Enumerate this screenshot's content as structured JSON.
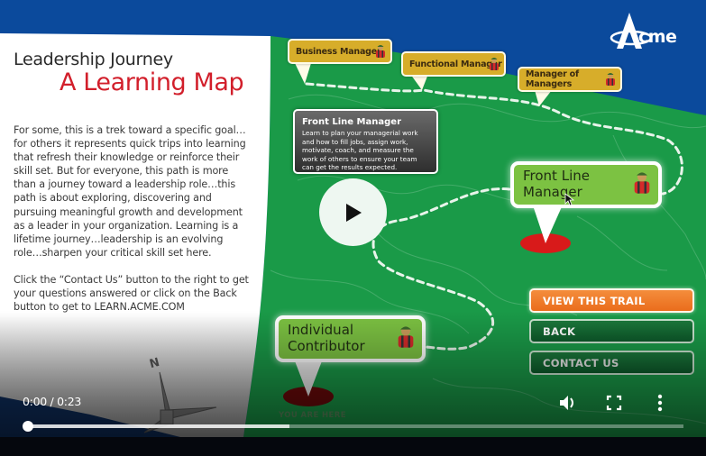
{
  "slide": {
    "title_line1": "Leadership Journey",
    "title_line2": "A Learning Map",
    "intro_paragraph1": "For some, this is a trek toward a specific goal…for others it represents quick trips into learning that refresh their knowledge or reinforce their skill set. But for everyone, this path is more than a journey toward a leadership role…this path is about exploring, discovering and pursuing meaningful growth and development as a leader in your organization. Learning is a lifetime journey…leadership is an evolving role…sharpen your critical skill set here.",
    "intro_paragraph2": "Click the “Contact Us” button to the right to get your questions answered or click on the Back button to get to LEARN.ACME.COM",
    "logo_text": "cme",
    "logo_letter": "A",
    "compass_label": "N",
    "milestones": {
      "business_manager": "Business Manager",
      "functional_manager": "Functional Manager",
      "manager_of_managers": "Manager of Managers",
      "front_line_manager": "Front Line Manager",
      "individual_contributor": "Individual Contributor"
    },
    "info_box": {
      "title": "Front Line Manager",
      "body": "Learn to plan your managerial work and how to fill jobs, assign work, motivate, coach, and measure the work of others to ensure your team can get the results expected."
    },
    "buttons": {
      "view_trail": "VIEW THIS TRAIL",
      "back": "BACK",
      "contact_us": "CONTACT US"
    },
    "you_are_here": "YOU ARE HERE",
    "colors": {
      "brand_blue": "#0b4a9c",
      "map_green": "#1a9a48",
      "title_red": "#d21f2b",
      "callout_gold": "#d7ad2a",
      "callout_green": "#7cc242",
      "button_orange": "#f07a2a",
      "pin_red": "#d81a1a"
    }
  },
  "player": {
    "time_display": "0:00 / 0:23",
    "current_time": "0:00",
    "duration": "0:23",
    "played_fraction": 0.0,
    "buffered_fraction": 0.4,
    "icons": {
      "play": "play-icon",
      "volume": "volume-icon",
      "fullscreen": "fullscreen-icon",
      "more": "more-vert-icon"
    }
  }
}
